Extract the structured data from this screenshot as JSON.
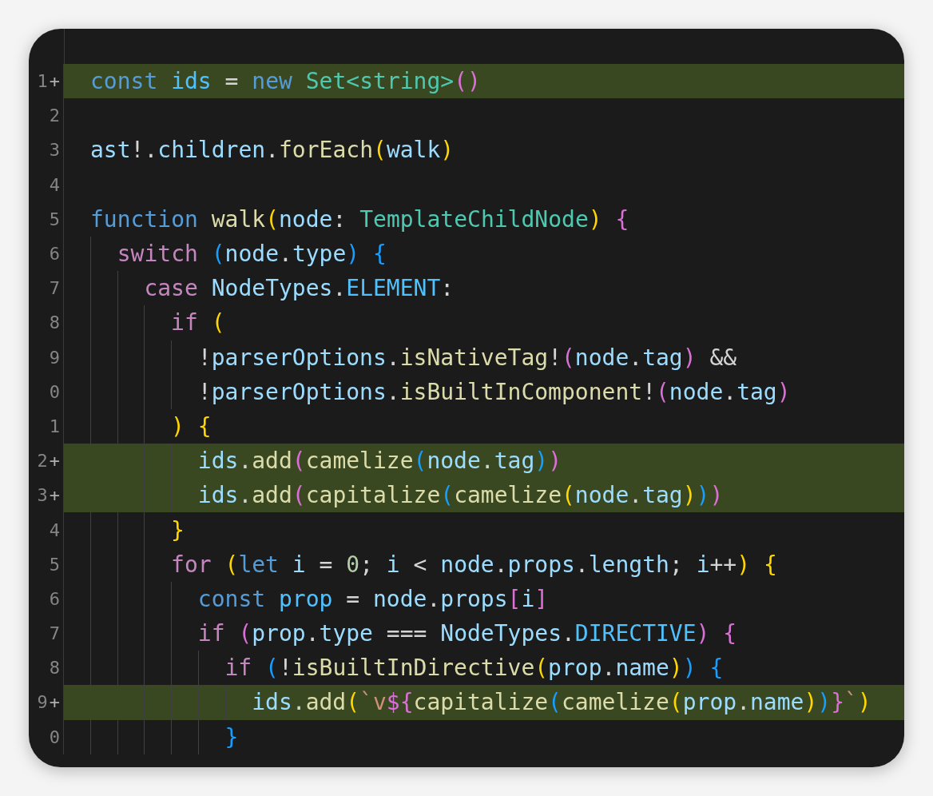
{
  "editor": {
    "lines": [
      {
        "number": "1",
        "added": true,
        "marker": "+",
        "tokens": [
          {
            "text": "const ",
            "kind": "keyword"
          },
          {
            "text": "ids",
            "kind": "constant"
          },
          {
            "text": " = ",
            "kind": "plain"
          },
          {
            "text": "new ",
            "kind": "keyword"
          },
          {
            "text": "Set",
            "kind": "type"
          },
          {
            "text": "<",
            "kind": "type"
          },
          {
            "text": "string",
            "kind": "type"
          },
          {
            "text": ">",
            "kind": "type"
          },
          {
            "text": "()",
            "kind": "bracket2"
          }
        ]
      },
      {
        "number": "2",
        "added": false
      },
      {
        "number": "3",
        "added": false,
        "tokens": [
          {
            "text": "ast",
            "kind": "variable"
          },
          {
            "text": "!.",
            "kind": "plain"
          },
          {
            "text": "children",
            "kind": "variable"
          },
          {
            "text": ".",
            "kind": "plain"
          },
          {
            "text": "forEach",
            "kind": "function"
          },
          {
            "text": "(",
            "kind": "bracket1"
          },
          {
            "text": "walk",
            "kind": "variable"
          },
          {
            "text": ")",
            "kind": "bracket1"
          }
        ]
      },
      {
        "number": "4",
        "added": false
      },
      {
        "number": "5",
        "added": false,
        "tokens": [
          {
            "text": "function ",
            "kind": "keyword"
          },
          {
            "text": "walk",
            "kind": "function"
          },
          {
            "text": "(",
            "kind": "bracket1"
          },
          {
            "text": "node",
            "kind": "variable"
          },
          {
            "text": ": ",
            "kind": "plain"
          },
          {
            "text": "TemplateChildNode",
            "kind": "type"
          },
          {
            "text": ") ",
            "kind": "bracket1"
          },
          {
            "text": "{",
            "kind": "bracket2"
          }
        ],
        "children": [
          {
            "number": "6",
            "added": false,
            "tokens": [
              {
                "text": "switch ",
                "kind": "control"
              },
              {
                "text": "(",
                "kind": "bracket3"
              },
              {
                "text": "node",
                "kind": "variable"
              },
              {
                "text": ".",
                "kind": "plain"
              },
              {
                "text": "type",
                "kind": "variable"
              },
              {
                "text": ") {",
                "kind": "bracket3"
              }
            ],
            "children": [
              {
                "number": "7",
                "added": false,
                "tokens": [
                  {
                    "text": "case ",
                    "kind": "control"
                  },
                  {
                    "text": "NodeTypes",
                    "kind": "variable"
                  },
                  {
                    "text": ".",
                    "kind": "plain"
                  },
                  {
                    "text": "ELEMENT",
                    "kind": "constant"
                  },
                  {
                    "text": ":",
                    "kind": "plain"
                  }
                ],
                "children": [
                  {
                    "number": "8",
                    "added": false,
                    "tokens": [
                      {
                        "text": "if ",
                        "kind": "control"
                      },
                      {
                        "text": "(",
                        "kind": "bracket1"
                      }
                    ],
                    "children": [
                      {
                        "number": "9",
                        "added": false,
                        "tokens": [
                          {
                            "text": "!",
                            "kind": "plain"
                          },
                          {
                            "text": "parserOptions",
                            "kind": "variable"
                          },
                          {
                            "text": ".",
                            "kind": "plain"
                          },
                          {
                            "text": "isNativeTag",
                            "kind": "function"
                          },
                          {
                            "text": "!",
                            "kind": "plain"
                          },
                          {
                            "text": "(",
                            "kind": "bracket2"
                          },
                          {
                            "text": "node",
                            "kind": "variable"
                          },
                          {
                            "text": ".",
                            "kind": "plain"
                          },
                          {
                            "text": "tag",
                            "kind": "variable"
                          },
                          {
                            "text": ")",
                            "kind": "bracket2"
                          },
                          {
                            "text": " &&",
                            "kind": "plain"
                          }
                        ]
                      },
                      {
                        "number": "0",
                        "added": false,
                        "tokens": [
                          {
                            "text": "!",
                            "kind": "plain"
                          },
                          {
                            "text": "parserOptions",
                            "kind": "variable"
                          },
                          {
                            "text": ".",
                            "kind": "plain"
                          },
                          {
                            "text": "isBuiltInComponent",
                            "kind": "function"
                          },
                          {
                            "text": "!",
                            "kind": "plain"
                          },
                          {
                            "text": "(",
                            "kind": "bracket2"
                          },
                          {
                            "text": "node",
                            "kind": "variable"
                          },
                          {
                            "text": ".",
                            "kind": "plain"
                          },
                          {
                            "text": "tag",
                            "kind": "variable"
                          },
                          {
                            "text": ")",
                            "kind": "bracket2"
                          }
                        ]
                      }
                    ]
                  },
                  {
                    "number": "1",
                    "added": false,
                    "tokens": [
                      {
                        "text": ") {",
                        "kind": "bracket1"
                      }
                    ],
                    "children": [
                      {
                        "number": "2",
                        "added": true,
                        "marker": "+",
                        "tokens": [
                          {
                            "text": "ids",
                            "kind": "variable"
                          },
                          {
                            "text": ".",
                            "kind": "plain"
                          },
                          {
                            "text": "add",
                            "kind": "function"
                          },
                          {
                            "text": "(",
                            "kind": "bracket2"
                          },
                          {
                            "text": "camelize",
                            "kind": "function"
                          },
                          {
                            "text": "(",
                            "kind": "bracket3"
                          },
                          {
                            "text": "node",
                            "kind": "variable"
                          },
                          {
                            "text": ".",
                            "kind": "plain"
                          },
                          {
                            "text": "tag",
                            "kind": "variable"
                          },
                          {
                            "text": ")",
                            "kind": "bracket3"
                          },
                          {
                            "text": ")",
                            "kind": "bracket2"
                          }
                        ]
                      },
                      {
                        "number": "3",
                        "added": true,
                        "marker": "+",
                        "tokens": [
                          {
                            "text": "ids",
                            "kind": "variable"
                          },
                          {
                            "text": ".",
                            "kind": "plain"
                          },
                          {
                            "text": "add",
                            "kind": "function"
                          },
                          {
                            "text": "(",
                            "kind": "bracket2"
                          },
                          {
                            "text": "capitalize",
                            "kind": "function"
                          },
                          {
                            "text": "(",
                            "kind": "bracket3"
                          },
                          {
                            "text": "camelize",
                            "kind": "function"
                          },
                          {
                            "text": "(",
                            "kind": "bracket1"
                          },
                          {
                            "text": "node",
                            "kind": "variable"
                          },
                          {
                            "text": ".",
                            "kind": "plain"
                          },
                          {
                            "text": "tag",
                            "kind": "variable"
                          },
                          {
                            "text": ")",
                            "kind": "bracket1"
                          },
                          {
                            "text": ")",
                            "kind": "bracket3"
                          },
                          {
                            "text": ")",
                            "kind": "bracket2"
                          }
                        ]
                      }
                    ]
                  },
                  {
                    "number": "4",
                    "added": false,
                    "tokens": [
                      {
                        "text": "}",
                        "kind": "bracket1"
                      }
                    ]
                  },
                  {
                    "number": "5",
                    "added": false,
                    "tokens": [
                      {
                        "text": "for ",
                        "kind": "control"
                      },
                      {
                        "text": "(",
                        "kind": "bracket1"
                      },
                      {
                        "text": "let ",
                        "kind": "keyword"
                      },
                      {
                        "text": "i",
                        "kind": "variable"
                      },
                      {
                        "text": " = ",
                        "kind": "plain"
                      },
                      {
                        "text": "0",
                        "kind": "number"
                      },
                      {
                        "text": "; ",
                        "kind": "plain"
                      },
                      {
                        "text": "i",
                        "kind": "variable"
                      },
                      {
                        "text": " < ",
                        "kind": "plain"
                      },
                      {
                        "text": "node",
                        "kind": "variable"
                      },
                      {
                        "text": ".",
                        "kind": "plain"
                      },
                      {
                        "text": "props",
                        "kind": "variable"
                      },
                      {
                        "text": ".",
                        "kind": "plain"
                      },
                      {
                        "text": "length",
                        "kind": "variable"
                      },
                      {
                        "text": "; ",
                        "kind": "plain"
                      },
                      {
                        "text": "i",
                        "kind": "variable"
                      },
                      {
                        "text": "++",
                        "kind": "plain"
                      },
                      {
                        "text": ") {",
                        "kind": "bracket1"
                      }
                    ],
                    "children": [
                      {
                        "number": "6",
                        "added": false,
                        "tokens": [
                          {
                            "text": "const ",
                            "kind": "keyword"
                          },
                          {
                            "text": "prop",
                            "kind": "constant"
                          },
                          {
                            "text": " = ",
                            "kind": "plain"
                          },
                          {
                            "text": "node",
                            "kind": "variable"
                          },
                          {
                            "text": ".",
                            "kind": "plain"
                          },
                          {
                            "text": "props",
                            "kind": "variable"
                          },
                          {
                            "text": "[",
                            "kind": "bracket2"
                          },
                          {
                            "text": "i",
                            "kind": "variable"
                          },
                          {
                            "text": "]",
                            "kind": "bracket2"
                          }
                        ]
                      },
                      {
                        "number": "7",
                        "added": false,
                        "tokens": [
                          {
                            "text": "if ",
                            "kind": "control"
                          },
                          {
                            "text": "(",
                            "kind": "bracket2"
                          },
                          {
                            "text": "prop",
                            "kind": "variable"
                          },
                          {
                            "text": ".",
                            "kind": "plain"
                          },
                          {
                            "text": "type",
                            "kind": "variable"
                          },
                          {
                            "text": " === ",
                            "kind": "plain"
                          },
                          {
                            "text": "NodeTypes",
                            "kind": "variable"
                          },
                          {
                            "text": ".",
                            "kind": "plain"
                          },
                          {
                            "text": "DIRECTIVE",
                            "kind": "constant"
                          },
                          {
                            "text": ") {",
                            "kind": "bracket2"
                          }
                        ],
                        "children": [
                          {
                            "number": "8",
                            "added": false,
                            "tokens": [
                              {
                                "text": "if ",
                                "kind": "control"
                              },
                              {
                                "text": "(",
                                "kind": "bracket3"
                              },
                              {
                                "text": "!",
                                "kind": "plain"
                              },
                              {
                                "text": "isBuiltInDirective",
                                "kind": "function"
                              },
                              {
                                "text": "(",
                                "kind": "bracket1"
                              },
                              {
                                "text": "prop",
                                "kind": "variable"
                              },
                              {
                                "text": ".",
                                "kind": "plain"
                              },
                              {
                                "text": "name",
                                "kind": "variable"
                              },
                              {
                                "text": ")",
                                "kind": "bracket1"
                              },
                              {
                                "text": ") {",
                                "kind": "bracket3"
                              }
                            ],
                            "children": [
                              {
                                "number": "9",
                                "added": true,
                                "marker": "+",
                                "tokens": [
                                  {
                                    "text": "ids",
                                    "kind": "variable"
                                  },
                                  {
                                    "text": ".",
                                    "kind": "plain"
                                  },
                                  {
                                    "text": "add",
                                    "kind": "function"
                                  },
                                  {
                                    "text": "(",
                                    "kind": "bracket1"
                                  },
                                  {
                                    "text": "`v",
                                    "kind": "string"
                                  },
                                  {
                                    "text": "${",
                                    "kind": "bracket2"
                                  },
                                  {
                                    "text": "capitalize",
                                    "kind": "function"
                                  },
                                  {
                                    "text": "(",
                                    "kind": "bracket3"
                                  },
                                  {
                                    "text": "camelize",
                                    "kind": "function"
                                  },
                                  {
                                    "text": "(",
                                    "kind": "bracket1"
                                  },
                                  {
                                    "text": "prop",
                                    "kind": "variable"
                                  },
                                  {
                                    "text": ".",
                                    "kind": "plain"
                                  },
                                  {
                                    "text": "name",
                                    "kind": "variable"
                                  },
                                  {
                                    "text": ")",
                                    "kind": "bracket1"
                                  },
                                  {
                                    "text": ")",
                                    "kind": "bracket3"
                                  },
                                  {
                                    "text": "}",
                                    "kind": "bracket2"
                                  },
                                  {
                                    "text": "`",
                                    "kind": "string"
                                  },
                                  {
                                    "text": ")",
                                    "kind": "bracket1"
                                  }
                                ]
                              }
                            ]
                          },
                          {
                            "number": "0",
                            "added": false,
                            "tokens": [
                              {
                                "text": "}",
                                "kind": "bracket3"
                              }
                            ]
                          }
                        ]
                      }
                    ]
                  }
                ]
              }
            ]
          }
        ]
      }
    ]
  }
}
